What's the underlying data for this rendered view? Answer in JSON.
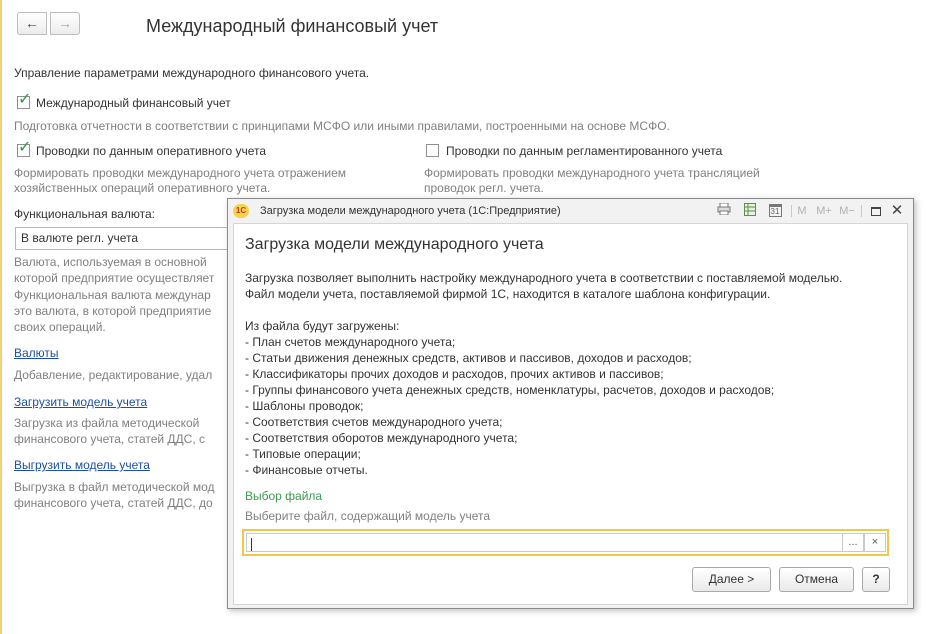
{
  "window": {
    "title": "Международный финансовый учет",
    "back_icon": "←",
    "forward_icon": "→"
  },
  "form": {
    "intro": "Управление параметрами международного финансового учета.",
    "ifrs_checkbox": {
      "label": "Международный финансовый учет",
      "checked": true
    },
    "ifrs_hint": "Подготовка отчетности в соответствии с принципами МСФО или иными правилами, построенными на основе МСФО.",
    "operational_checkbox": {
      "label": "Проводки по данным оперативного учета",
      "checked": true
    },
    "operational_hint_1": "Формировать проводки международного учета отражением",
    "operational_hint_2": "хозяйственных операций оперативного учета.",
    "regulated_checkbox": {
      "label": "Проводки по данным регламентированного учета",
      "checked": false
    },
    "regulated_hint_1": "Формировать проводки международного учета трансляцией",
    "regulated_hint_2": "проводок регл. учета.",
    "currency_label": "Функциональная валюта:",
    "currency_value": "В валюте регл. учета",
    "currency_hint_1": "Валюта, используемая в основной",
    "currency_hint_2": "которой предприятие осуществляет",
    "currency_hint_3": "Функциональная валюта междунар",
    "currency_hint_4": "это валюта, в которой предприятие",
    "currency_hint_5": "своих операций.",
    "currencies_link": "Валюты",
    "currencies_hint": "Добавление, редактирование, удал",
    "load_link": "Загрузить модель учета",
    "load_hint_1": "Загрузка из файла методической",
    "load_hint_2": "финансового учета, статей ДДС, с",
    "unload_link": "Выгрузить модель учета",
    "unload_hint_1": "Выгрузка в файл методической мод",
    "unload_hint_2": "финансового учета, статей ДДС, до"
  },
  "modal": {
    "window_title": "Загрузка модели международного учета  (1С:Предприятие)",
    "logo_text": "1С",
    "toolbar": {
      "m": "M",
      "m_plus": "M+",
      "m_minus": "M−",
      "calendar_day": "31"
    },
    "heading": "Загрузка модели международного учета",
    "description_1": "Загрузка позволяет выполнить настройку международного учета в соответствии с поставляемой моделью.",
    "description_2": "Файл модели учета, поставляемой фирмой 1С, находится в каталоге шаблона конфигурации.",
    "list_header": "Из файла будут загружены:",
    "list_items": [
      "- План счетов международного учета;",
      "- Статьи движения денежных средств, активов и пассивов, доходов и расходов;",
      "- Классификаторы прочих доходов и расходов, прочих активов и пассивов;",
      "- Группы финансового учета денежных средств, номенклатуры, расчетов, доходов и расходов;",
      "- Шаблоны проводок;",
      "- Соответствия счетов международного учета;",
      "- Соответствия оборотов международного учета;",
      "- Типовые операции;",
      "- Финансовые отчеты."
    ],
    "file_section_title": "Выбор файла",
    "file_hint": "Выберите файл, содержащий модель учета",
    "file_value": "",
    "browse_label": "...",
    "clear_label": "×",
    "next_button": "Далее >",
    "cancel_button": "Отмена",
    "help_button": "?"
  },
  "colors": {
    "accent_yellow": "#f0c94a",
    "link_blue": "#1d4fa1",
    "section_green": "#3a9a4d",
    "check_green": "#2e9e34",
    "hint_gray": "#808080"
  }
}
